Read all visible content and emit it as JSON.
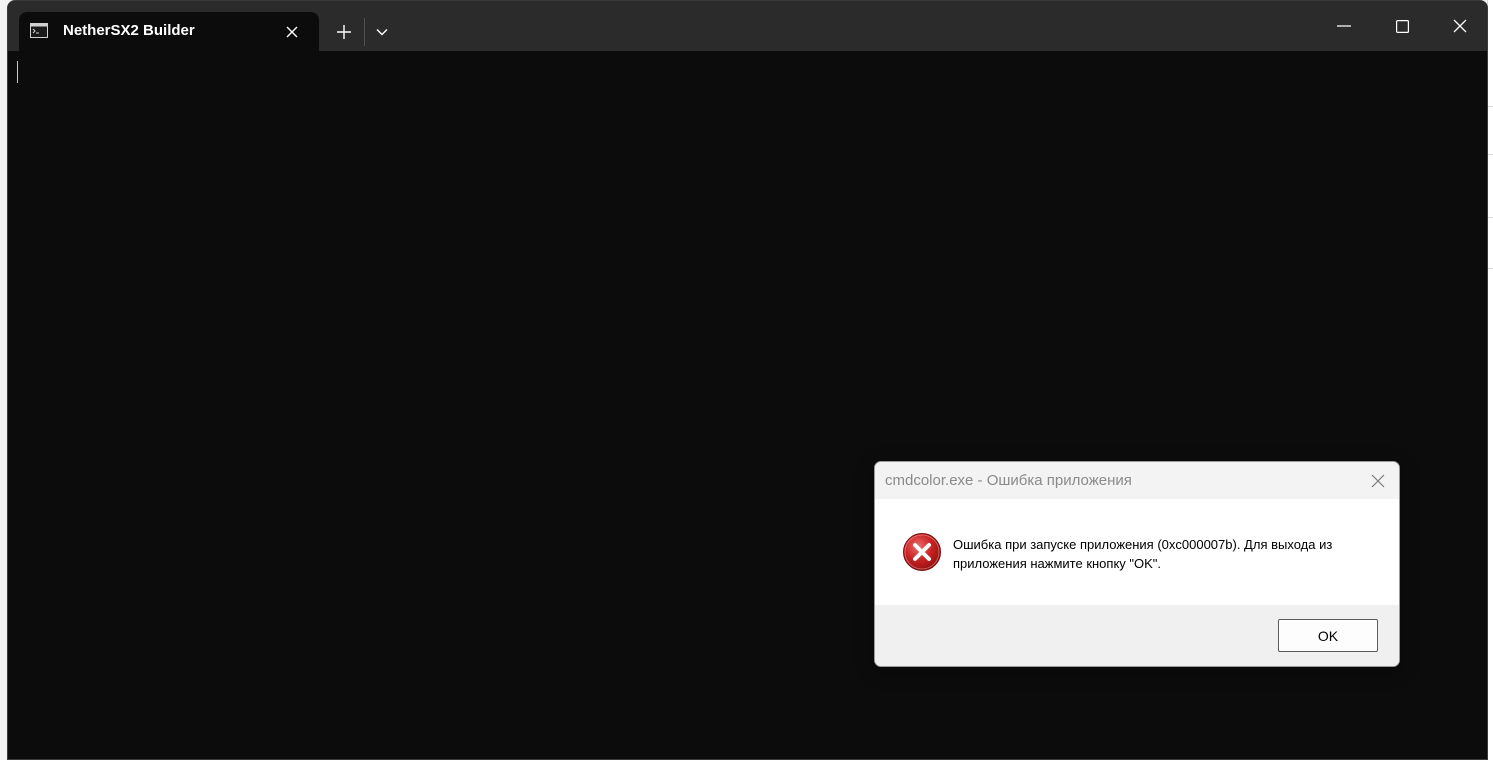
{
  "terminal": {
    "tab_title": "NetherSX2 Builder",
    "icons": {
      "tab": "console-icon",
      "tab_close": "close-icon",
      "new_tab": "plus-icon",
      "dropdown": "chevron-down-icon",
      "minimize": "minimize-icon",
      "maximize": "maximize-icon",
      "close": "close-icon"
    },
    "colors": {
      "titlebar": "#2b2b2b",
      "console_background": "#0c0c0c",
      "tab_text": "#ffffff"
    }
  },
  "dialog": {
    "title": "cmdcolor.exe - Ошибка приложения",
    "message": "Ошибка при запуске приложения (0xc000007b). Для выхода из приложения нажмите кнопку \"OK\".",
    "ok_label": "OK",
    "icons": {
      "status": "error-icon",
      "close": "close-icon"
    },
    "colors": {
      "error_red": "#c62121",
      "title_text": "#8a8a8a"
    }
  }
}
